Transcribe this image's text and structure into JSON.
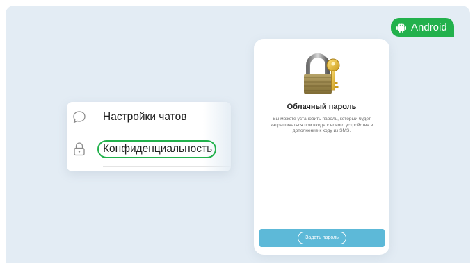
{
  "badge": {
    "label": "Android",
    "icon": "android-icon"
  },
  "settings": {
    "items": [
      {
        "label": "Настройки чатов",
        "icon": "chat-bubble-icon"
      },
      {
        "label": "Конфиденциальность",
        "icon": "lock-icon",
        "highlighted": true
      }
    ]
  },
  "cloud_password": {
    "icon": "padlock-key-icon",
    "title": "Облачный пароль",
    "description": "Вы можете установить пароль, который будет запрашиваться при входе с нового устройства в дополнение к коду из SMS.",
    "button_label": "Задать пароль"
  },
  "colors": {
    "accent_green": "#22b14c",
    "button_blue": "#5db9d8",
    "background": "#e3ecf4"
  }
}
